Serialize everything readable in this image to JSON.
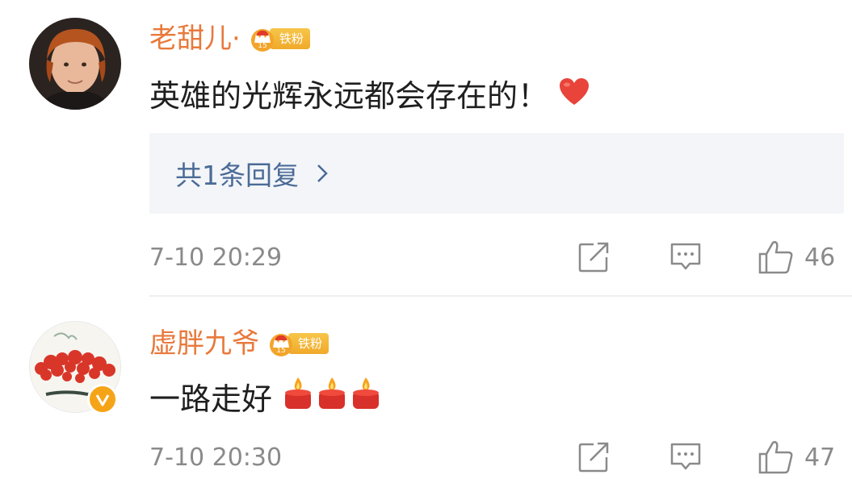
{
  "comments": [
    {
      "username": "老甜儿·",
      "fan_badge": "铁粉",
      "text": "英雄的光辉永远都会存在的！",
      "emoji": "heart-emoji",
      "reply_link": "共1条回复",
      "timestamp": "7-10 20:29",
      "likes": "46"
    },
    {
      "username": "虚胖九爷",
      "fan_badge": "铁粉",
      "text": "一路走好",
      "emoji": "candle-emoji",
      "timestamp": "7-10 20:30",
      "likes": "47"
    }
  ],
  "colors": {
    "username": "#e8793b",
    "link": "#4b6b97",
    "meta": "#8a8a8a",
    "badge": "#f0a92a",
    "reply_bg": "#f3f5f8"
  }
}
